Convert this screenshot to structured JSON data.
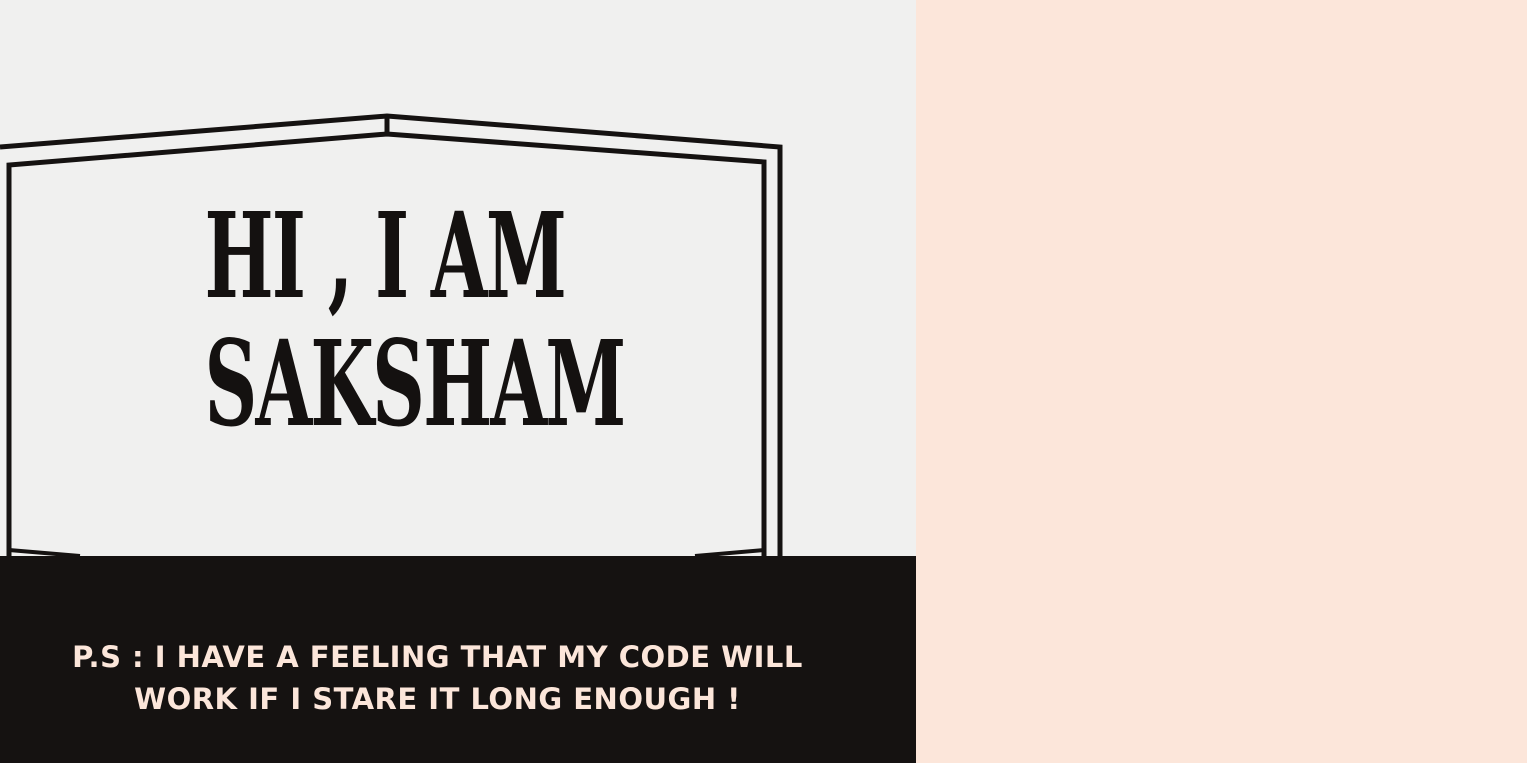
{
  "slide": {
    "title_line1": "HI , I AM",
    "title_line2": "SAKSHAM",
    "subtitle": "P.S :    I HAVE A FEELING THAT MY CODE WILL WORK IF I STARE IT LONG ENOUGH !"
  },
  "colors": {
    "left_background": "#f0f0ef",
    "right_background": "#fce6da",
    "dark_band": "#151211",
    "title_text": "#141110",
    "subtitle_text": "#fce6da"
  }
}
